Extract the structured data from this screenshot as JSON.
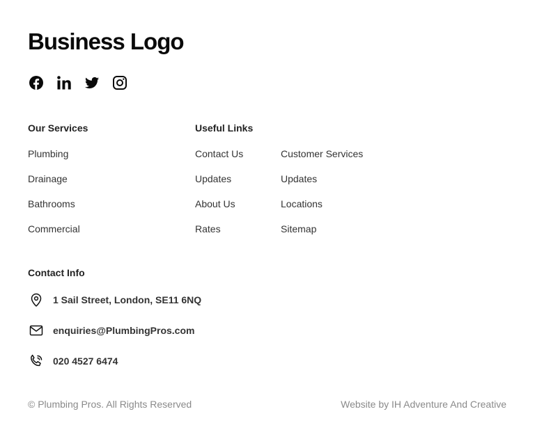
{
  "brand": {
    "logo_text": "Business Logo"
  },
  "socials": [
    {
      "icon": "facebook-icon"
    },
    {
      "icon": "linkedin-icon"
    },
    {
      "icon": "twitter-icon"
    },
    {
      "icon": "instagram-icon"
    }
  ],
  "services": {
    "heading": "Our Services",
    "items": [
      "Plumbing",
      "Drainage",
      "Bathrooms",
      "Commercial"
    ]
  },
  "useful_links": {
    "heading": "Useful Links",
    "col1": [
      "Contact Us",
      "Updates",
      "About Us",
      "Rates"
    ],
    "col2": [
      "Customer Services",
      "Updates",
      "Locations",
      "Sitemap"
    ]
  },
  "contact": {
    "heading": "Contact Info",
    "address": "1 Sail Street, London, SE11 6NQ",
    "email": "enquiries@PlumbingPros.com",
    "phone": "020 4527 6474"
  },
  "footer": {
    "copyright": "© Plumbing Pros. All Rights Reserved",
    "credit": "Website by IH Adventure And Creative"
  }
}
